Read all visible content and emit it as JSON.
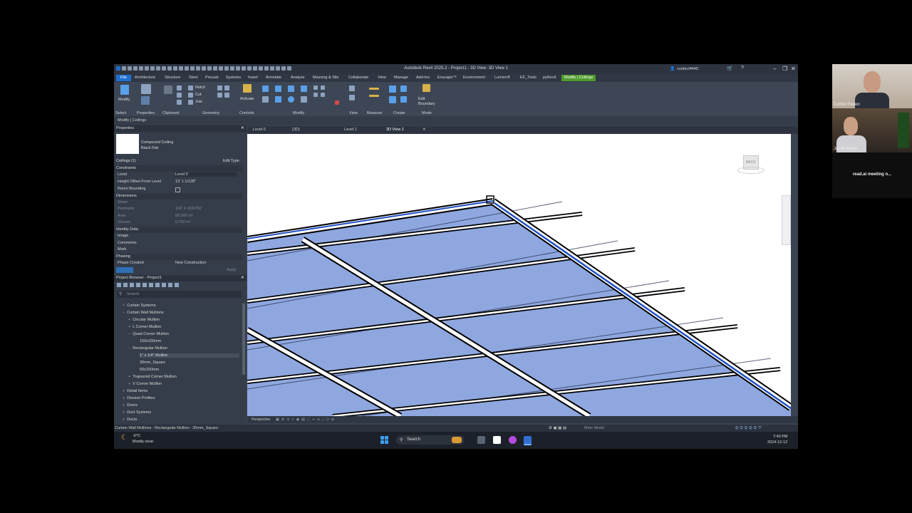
{
  "window": {
    "title": "Autodesk Revit 2025.2 - Project1 - 3D View: 3D View 1",
    "user": "corbinJ444C"
  },
  "ribbon_tabs": [
    "File",
    "Architecture",
    "Structure",
    "Steel",
    "Precast",
    "Systems",
    "Insert",
    "Annotate",
    "Analyze",
    "Massing & Site",
    "Collaborate",
    "View",
    "Manage",
    "Add-Ins",
    "Enscape™",
    "Environment",
    "Lumion®",
    "EF_Tools",
    "pyRevit",
    "Modify | Ceilings"
  ],
  "ribbon": {
    "modify": "Modify",
    "notch": "Notch",
    "cut": "Cut",
    "join": "Join",
    "activate": "Activate",
    "edit_boundary": "Edit Boundary",
    "groups": [
      "Select",
      "Properties",
      "Clipboard",
      "Geometry",
      "Controls",
      "Modify",
      "View",
      "Measure",
      "Create",
      "Mode"
    ]
  },
  "context_bar": "Modify | Ceilings",
  "properties": {
    "header": "Properties",
    "type_name": "Compound Ceiling",
    "type_sub": "Black Flat",
    "selector": "Ceilings (1)",
    "edit_type": "Edit Type",
    "groups": {
      "constraints": "Constraints",
      "dimensions": "Dimensions",
      "identity": "Identity Data",
      "phasing": "Phasing"
    },
    "rows": {
      "level_k": "Level",
      "level_v": "Level 0",
      "height_k": "Height Offset From Level",
      "height_v": "13'  1 1/128\"",
      "room_k": "Room Bounding",
      "slope_k": "Slope",
      "perimeter_k": "Perimeter",
      "perimeter_v": "100'  4 165/256\"",
      "area_k": "Area",
      "area_v": "58.500 m²",
      "volume_k": "Volume",
      "volume_v": "0.702 m³",
      "image_k": "Image",
      "comments_k": "Comments",
      "mark_k": "Mark",
      "phase_k": "Phase Created",
      "phase_v": "New Construction"
    },
    "apply": "Apply"
  },
  "browser": {
    "header": "Project Browser - Project1",
    "search_placeholder": "Search",
    "items": [
      "Curtain Systems",
      "Curtain Wall Mullions",
      "Circular Mullion",
      "L Corner Mullion",
      "Quad Corner Mullion",
      "150x150mm",
      "Rectangular Mullion",
      "1\" x 1/4\" Mullion",
      "30mm_Square",
      "50x150mm",
      "Trapezoid Corner Mullion",
      "V Corner Mullion",
      "Detail Items",
      "Division Profiles",
      "Doors",
      "Duct Systems",
      "Ducts"
    ]
  },
  "view_tabs": [
    "Level 0",
    "{3D}",
    "Level 1",
    "3D View 1"
  ],
  "viewcube_label": "BACK",
  "view_control": "Perspective",
  "status_bar": {
    "left": "Curtain Wall Mullions : Rectangular Mullion : 30mm_Square",
    "model": "Main Model"
  },
  "taskbar": {
    "temp": "-6°C",
    "weather": "Mostly clear",
    "search": "Search",
    "time": "7:40 PM",
    "date": "2024-12-12"
  },
  "meeting": {
    "p1": "Corbin Patten",
    "p2": "Jacob Burke",
    "bot": "read.ai meeting n..."
  }
}
